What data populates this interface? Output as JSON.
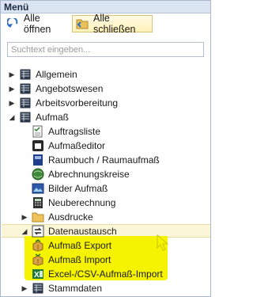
{
  "panel": {
    "title": "Menü"
  },
  "toolbar": {
    "open_all": "Alle öffnen",
    "close_all": "Alle schließen"
  },
  "search": {
    "placeholder": "Suchtext eingeben..."
  },
  "tree": {
    "items": [
      {
        "label": "Allgemein",
        "expander": "▶"
      },
      {
        "label": "Angebotswesen",
        "expander": "▶"
      },
      {
        "label": "Arbeitsvorbereitung",
        "expander": "▶"
      },
      {
        "label": "Aufmaß",
        "expander": "◢",
        "children": [
          {
            "label": "Auftragsliste"
          },
          {
            "label": "Aufmaßeditor"
          },
          {
            "label": "Raumbuch / Raumaufmaß"
          },
          {
            "label": "Abrechnungskreise"
          },
          {
            "label": "Bilder Aufmaß"
          },
          {
            "label": "Neuberechnung"
          },
          {
            "label": "Ausdrucke",
            "expander": "▶"
          },
          {
            "label": "Datenaustausch",
            "expander": "◢",
            "children": [
              {
                "label": "Aufmaß Export"
              },
              {
                "label": "Aufmaß Import"
              },
              {
                "label": "Excel-/CSV-Aufmaß-Import"
              }
            ]
          }
        ]
      },
      {
        "label": "Stammdaten",
        "expander": "▶"
      }
    ]
  },
  "colors": {
    "highlight": "#f5f300",
    "selection": "#fbf6d8",
    "titlebar": "#dbe4f1"
  }
}
